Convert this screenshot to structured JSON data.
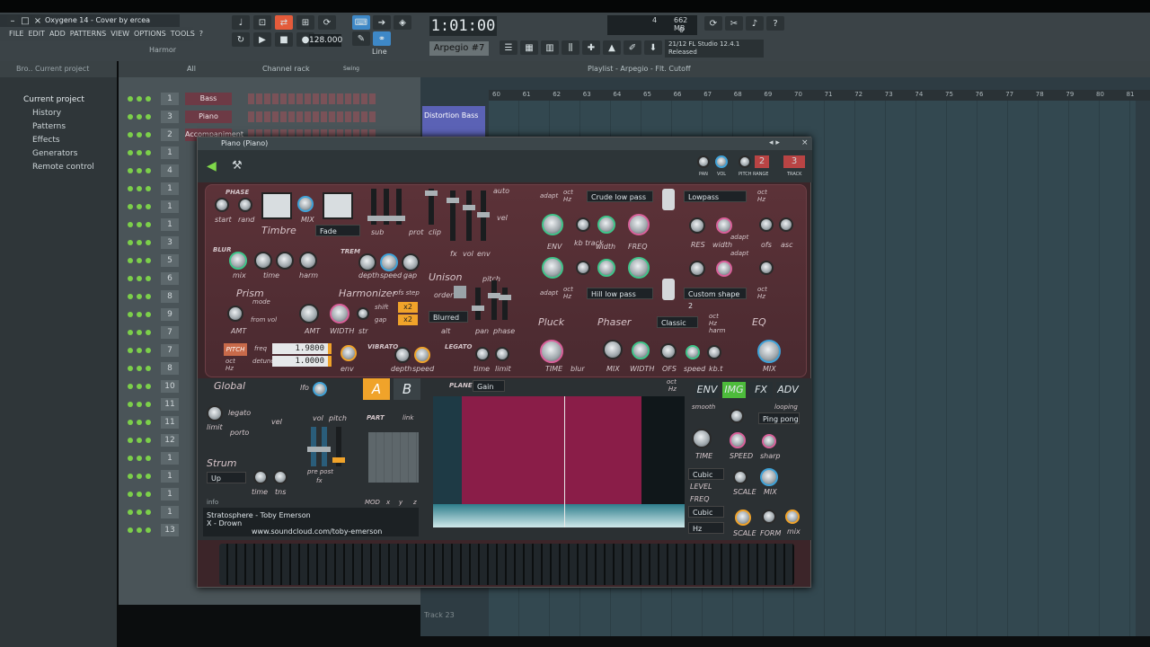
{
  "window": {
    "title": "Oxygene 14 - Cover by ercea"
  },
  "menu": [
    "FILE",
    "EDIT",
    "ADD",
    "PATTERNS",
    "VIEW",
    "OPTIONS",
    "TOOLS",
    "?"
  ],
  "toolbar": {
    "time": "1:01:00",
    "tempo": "128.000",
    "pattern": "Arpegio #7",
    "snap": "Line",
    "harmor": "Harmor",
    "cpu": "4",
    "mem": "662 MB",
    "poly": "0",
    "hint_line1": "21/12  FL Studio 12.4.1",
    "hint_line2": "Released"
  },
  "browser": {
    "header": "Bro..  Current project",
    "items": [
      {
        "label": "Current project",
        "top": true
      },
      {
        "label": "History"
      },
      {
        "label": "Patterns"
      },
      {
        "label": "Effects"
      },
      {
        "label": "Generators"
      },
      {
        "label": "Remote control"
      }
    ]
  },
  "channel_rack": {
    "filter": "All",
    "title": "Channel rack",
    "swing": "Swing",
    "rows": [
      {
        "num": "1",
        "name": "Bass"
      },
      {
        "num": "3",
        "name": "Piano"
      },
      {
        "num": "2",
        "name": "Accompaniment"
      },
      {
        "num": "1",
        "name": ""
      },
      {
        "num": "4",
        "name": ""
      },
      {
        "num": "1",
        "name": ""
      },
      {
        "num": "1",
        "name": ""
      },
      {
        "num": "1",
        "name": ""
      },
      {
        "num": "3",
        "name": ""
      },
      {
        "num": "5",
        "name": ""
      },
      {
        "num": "6",
        "name": ""
      },
      {
        "num": "8",
        "name": ""
      },
      {
        "num": "9",
        "name": ""
      },
      {
        "num": "7",
        "name": ""
      },
      {
        "num": "7",
        "name": ""
      },
      {
        "num": "8",
        "name": ""
      },
      {
        "num": "10",
        "name": ""
      },
      {
        "num": "11",
        "name": ""
      },
      {
        "num": "11",
        "name": ""
      },
      {
        "num": "12",
        "name": ""
      },
      {
        "num": "1",
        "name": ""
      },
      {
        "num": "1",
        "name": ""
      },
      {
        "num": "1",
        "name": ""
      },
      {
        "num": "1",
        "name": ""
      },
      {
        "num": "13",
        "name": ""
      }
    ]
  },
  "playlist": {
    "title": "Playlist - Arpegio - Flt. Cutoff",
    "ruler": [
      "60",
      "61",
      "62",
      "63",
      "64",
      "65",
      "66",
      "67",
      "68",
      "69",
      "70",
      "71",
      "72",
      "73",
      "74",
      "75",
      "76",
      "77",
      "78",
      "79",
      "80",
      "81"
    ],
    "clip": "Distortion Bass",
    "track23": "Track 23"
  },
  "plugin": {
    "title": "Piano (Piano)",
    "header_labels": {
      "pan": "PAN",
      "vol": "VOL",
      "pitch": "PITCH",
      "range": "RANGE",
      "track": "TRACK",
      "range_val": "2",
      "track_val": "3"
    },
    "timbre": {
      "phase": "PHASE",
      "start": "start",
      "rand": "rand",
      "mix": "MIX",
      "title": "Timbre",
      "fade": "Fade",
      "sub": "sub",
      "prot": "prot",
      "clip": "clip",
      "auto": "auto",
      "vel": "vel",
      "fx": "fx",
      "vol": "vol",
      "env": "env"
    },
    "blur": {
      "title": "BLUR",
      "mix": "mix",
      "time": "time",
      "harm": "harm",
      "trem": "TREM",
      "depth": "depth",
      "speed": "speed",
      "gap": "gap",
      "unison": "Unison",
      "pitch": "pitch",
      "order": "order",
      "pan": "pan",
      "phase": "phase",
      "blurred": "Blurred",
      "alt": "alt"
    },
    "prism": {
      "title": "Prism",
      "mode": "mode",
      "fromvol": "from vol",
      "amt": "AMT",
      "harmonizer": "Harmonizer",
      "ofsstep": "ofs step",
      "shift": "shift",
      "gap": "gap",
      "x2a": "x2",
      "x2b": "x2",
      "width": "WIDTH",
      "str": "str"
    },
    "pitch": {
      "pitch": "PITCH",
      "freq": "freq",
      "detune": "detune",
      "oct": "oct",
      "hz": "Hz",
      "freqval": "1.9800",
      "detuneval": "1.0000",
      "env": "env",
      "vibrato": "VIBRATO",
      "depth": "depth",
      "speed": "speed",
      "legato": "LEGATO",
      "time": "time",
      "limit": "limit"
    },
    "filter": {
      "adapt": "adapt",
      "oct": "oct",
      "hz": "Hz",
      "f1": "Crude low pass",
      "f2": "Lowpass",
      "f3": "Hill low pass",
      "f4": "Custom shape 2",
      "env": "ENV",
      "kbtrack": "kb track",
      "width": "width",
      "freq": "FREQ",
      "res": "RES",
      "width2": "width",
      "adapt2": "adapt",
      "ofs": "ofs",
      "asc": "asc"
    },
    "pluck": {
      "pluck": "Pluck",
      "phaser": "Phaser",
      "classic": "Classic",
      "oct": "oct",
      "hz": "Hz",
      "harm": "harm",
      "eq": "EQ",
      "time": "TIME",
      "blur": "blur",
      "mix": "MIX",
      "width": "WIDTH",
      "ofs": "OFS",
      "speed": "speed",
      "kbt": "kb.t",
      "mix2": "MIX"
    },
    "global": {
      "title": "Global",
      "legato": "legato",
      "limit": "limit",
      "porto": "porto",
      "vel": "vel",
      "lfo": "lfo",
      "vol": "vol",
      "pitch": "pitch",
      "strum": "Strum",
      "up": "Up",
      "time": "time",
      "tns": "tns",
      "prepost": "pre post",
      "fx": "fx",
      "a": "A",
      "b": "B",
      "part": "PART",
      "link": "link",
      "mod": "MOD",
      "x": "x",
      "y": "y",
      "z": "z"
    },
    "plane": {
      "label": "PLANE",
      "gain": "Gain",
      "oct": "oct",
      "hz": "Hz"
    },
    "right": {
      "tabs": [
        "ENV",
        "IMG",
        "FX",
        "ADV"
      ],
      "smooth": "smooth",
      "looping": "looping",
      "pingpong": "Ping pong",
      "time": "TIME",
      "speed": "SPEED",
      "sharp": "sharp",
      "cubic1": "Cubic",
      "level": "LEVEL",
      "scale": "SCALE",
      "mix": "MIX",
      "freq": "FREQ",
      "cubic2": "Cubic",
      "hz": "Hz",
      "scale2": "SCALE",
      "form": "FORM",
      "mix2": "mix"
    },
    "info": {
      "label": "info",
      "line1": "Stratosphere - Toby Emerson",
      "line2": "X - Drown",
      "url": "www.soundcloud.com/toby-emerson"
    }
  }
}
